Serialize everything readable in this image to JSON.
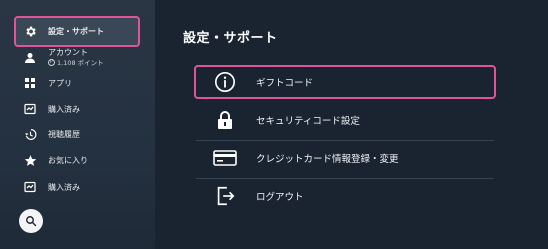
{
  "sidebar": {
    "items": [
      {
        "label": "設定・サポート",
        "icon": "gear-icon",
        "selected": true
      },
      {
        "label": "アカウント",
        "icon": "person-icon",
        "points": "1,108 ポイント"
      },
      {
        "label": "アプリ",
        "icon": "apps-grid-icon"
      },
      {
        "label": "購入済み",
        "icon": "purchased-icon"
      },
      {
        "label": "視聴履歴",
        "icon": "history-icon"
      },
      {
        "label": "お気に入り",
        "icon": "star-icon"
      },
      {
        "label": "購入済み",
        "icon": "purchased-icon"
      }
    ],
    "search_icon": "search-icon"
  },
  "main": {
    "title": "設定・サポート",
    "items": [
      {
        "label": "ギフトコード",
        "icon": "info-icon",
        "selected": true
      },
      {
        "label": "セキュリティコード設定",
        "icon": "lock-icon"
      },
      {
        "label": "クレジットカード情報登録・変更",
        "icon": "credit-card-icon"
      },
      {
        "label": "ログアウト",
        "icon": "logout-icon"
      }
    ]
  },
  "colors": {
    "highlight": "#e0559a",
    "background": "#1a2330",
    "sidebar": "#2a3644"
  }
}
